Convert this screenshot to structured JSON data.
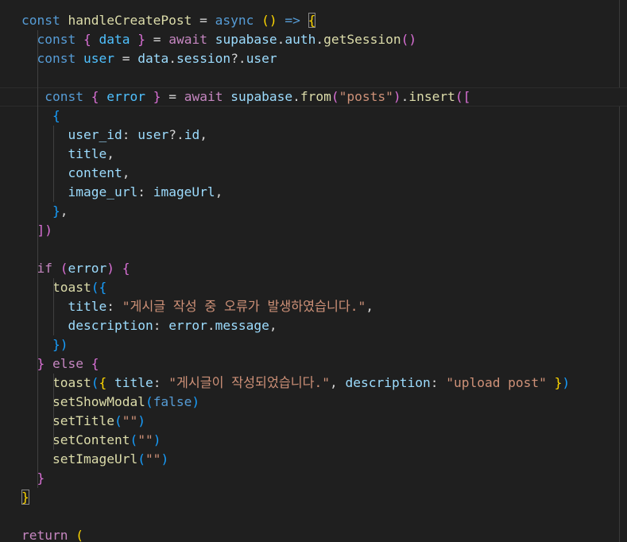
{
  "editor": {
    "language": "javascript",
    "theme": "Dark Modern",
    "lines": [
      [
        [
          "const",
          "kw"
        ],
        [
          " "
        ],
        [
          "handleCreatePost",
          "fn"
        ],
        [
          " = "
        ],
        [
          "async",
          "kw"
        ],
        [
          " "
        ],
        [
          "()",
          "b1"
        ],
        [
          " "
        ],
        [
          "=>",
          "kw"
        ],
        [
          " "
        ],
        [
          "{",
          "b1m"
        ]
      ],
      [
        [
          "  "
        ],
        [
          "const",
          "kw"
        ],
        [
          " "
        ],
        [
          "{",
          "b2"
        ],
        [
          " "
        ],
        [
          "data",
          "cst"
        ],
        [
          " "
        ],
        [
          "}",
          "b2"
        ],
        [
          " = "
        ],
        [
          "await",
          "cf"
        ],
        [
          " "
        ],
        [
          "supabase",
          "var"
        ],
        [
          "."
        ],
        [
          "auth",
          "var"
        ],
        [
          "."
        ],
        [
          "getSession",
          "fn"
        ],
        [
          "()",
          "b2"
        ]
      ],
      [
        [
          "  "
        ],
        [
          "const",
          "kw"
        ],
        [
          " "
        ],
        [
          "user",
          "cst"
        ],
        [
          " = "
        ],
        [
          "data",
          "var"
        ],
        [
          "."
        ],
        [
          "session",
          "var"
        ],
        [
          "?."
        ],
        [
          "user",
          "var"
        ]
      ],
      [],
      [
        [
          "   "
        ],
        [
          "const",
          "kw"
        ],
        [
          " "
        ],
        [
          "{",
          "b2"
        ],
        [
          " "
        ],
        [
          "error",
          "cst"
        ],
        [
          " "
        ],
        [
          "}",
          "b2"
        ],
        [
          " = "
        ],
        [
          "await",
          "cf"
        ],
        [
          " "
        ],
        [
          "supabase",
          "var"
        ],
        [
          "."
        ],
        [
          "from",
          "fn"
        ],
        [
          "(",
          "b2"
        ],
        [
          "\"posts\"",
          "str"
        ],
        [
          ")",
          "b2"
        ],
        [
          "."
        ],
        [
          "insert",
          "fn"
        ],
        [
          "([",
          "b2"
        ]
      ],
      [
        [
          "    "
        ],
        [
          "{",
          "b3"
        ]
      ],
      [
        [
          "      "
        ],
        [
          "user_id",
          "var"
        ],
        [
          ": "
        ],
        [
          "user",
          "var"
        ],
        [
          "?."
        ],
        [
          "id",
          "var"
        ],
        [
          ","
        ]
      ],
      [
        [
          "      "
        ],
        [
          "title",
          "var"
        ],
        [
          ","
        ]
      ],
      [
        [
          "      "
        ],
        [
          "content",
          "var"
        ],
        [
          ","
        ]
      ],
      [
        [
          "      "
        ],
        [
          "image_url",
          "var"
        ],
        [
          ": "
        ],
        [
          "imageUrl",
          "var"
        ],
        [
          ","
        ]
      ],
      [
        [
          "    "
        ],
        [
          "}",
          "b3"
        ],
        [
          ","
        ]
      ],
      [
        [
          "  "
        ],
        [
          "])",
          "b2"
        ]
      ],
      [],
      [
        [
          "  "
        ],
        [
          "if",
          "cf"
        ],
        [
          " "
        ],
        [
          "(",
          "b2"
        ],
        [
          "error",
          "var"
        ],
        [
          ")",
          "b2"
        ],
        [
          " "
        ],
        [
          "{",
          "b2"
        ]
      ],
      [
        [
          "    "
        ],
        [
          "toast",
          "fn"
        ],
        [
          "({",
          "b3"
        ]
      ],
      [
        [
          "      "
        ],
        [
          "title",
          "var"
        ],
        [
          ": "
        ],
        [
          "\"게시글 작성 중 오류가 발생하였습니다.\"",
          "str"
        ],
        [
          ","
        ]
      ],
      [
        [
          "      "
        ],
        [
          "description",
          "var"
        ],
        [
          ": "
        ],
        [
          "error",
          "var"
        ],
        [
          "."
        ],
        [
          "message",
          "var"
        ],
        [
          ","
        ]
      ],
      [
        [
          "    "
        ],
        [
          "})",
          "b3"
        ]
      ],
      [
        [
          "  "
        ],
        [
          "}",
          "b2"
        ],
        [
          " "
        ],
        [
          "else",
          "cf"
        ],
        [
          " "
        ],
        [
          "{",
          "b2"
        ]
      ],
      [
        [
          "    "
        ],
        [
          "toast",
          "fn"
        ],
        [
          "(",
          "b3"
        ],
        [
          "{",
          "b1"
        ],
        [
          " "
        ],
        [
          "title",
          "var"
        ],
        [
          ": "
        ],
        [
          "\"게시글이 작성되었습니다.\"",
          "str"
        ],
        [
          ", "
        ],
        [
          "description",
          "var"
        ],
        [
          ": "
        ],
        [
          "\"upload post\"",
          "str"
        ],
        [
          " "
        ],
        [
          "}",
          "b1"
        ],
        [
          ")",
          "b3"
        ]
      ],
      [
        [
          "    "
        ],
        [
          "setShowModal",
          "fn"
        ],
        [
          "(",
          "b3"
        ],
        [
          "false",
          "kw"
        ],
        [
          ")",
          "b3"
        ]
      ],
      [
        [
          "    "
        ],
        [
          "setTitle",
          "fn"
        ],
        [
          "(",
          "b3"
        ],
        [
          "\"\"",
          "str"
        ],
        [
          ")",
          "b3"
        ]
      ],
      [
        [
          "    "
        ],
        [
          "setContent",
          "fn"
        ],
        [
          "(",
          "b3"
        ],
        [
          "\"\"",
          "str"
        ],
        [
          ")",
          "b3"
        ]
      ],
      [
        [
          "    "
        ],
        [
          "setImageUrl",
          "fn"
        ],
        [
          "(",
          "b3"
        ],
        [
          "\"\"",
          "str"
        ],
        [
          ")",
          "b3"
        ]
      ],
      [
        [
          "  "
        ],
        [
          "}",
          "b2"
        ]
      ],
      [
        [
          "}",
          "b1m"
        ]
      ],
      [],
      [
        [
          "return",
          "cf"
        ],
        [
          " "
        ],
        [
          "(",
          "b1"
        ]
      ]
    ],
    "current_line": 4,
    "colors": {
      "background": "#1f1f1f",
      "keyword": "#569cd6",
      "control": "#c586c0",
      "function": "#dcdcaa",
      "variable": "#9cdcfe",
      "constant": "#4fc1ff",
      "string": "#ce9178",
      "bracket_1": "#ffd700",
      "bracket_2": "#da70d6",
      "bracket_3": "#179fff"
    }
  }
}
